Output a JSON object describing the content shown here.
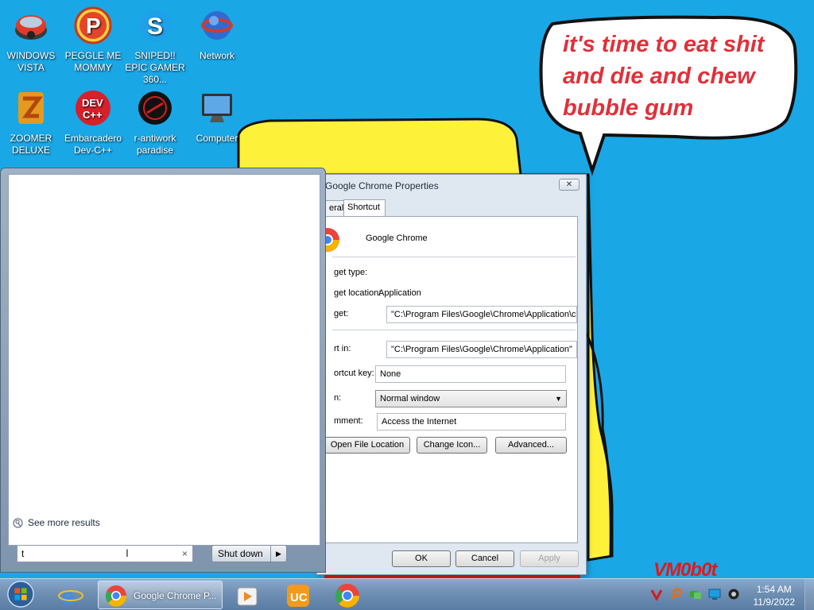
{
  "desktop": {
    "meme_text": "it's time to eat shit and die and chew bubble gum",
    "watermark": "VM0b0t",
    "icons": [
      {
        "label": "WINDOWS VISTA",
        "icon": "windows-vista-icon"
      },
      {
        "label": "PEGGLE ME MOMMY",
        "icon": "peggle-icon"
      },
      {
        "label": "SNIPED!! EPIC GAMER 360...",
        "icon": "skype-icon"
      },
      {
        "label": "Network",
        "icon": "network-icon"
      },
      {
        "label": "ZOOMER DELUXE",
        "icon": "zoomer-icon"
      },
      {
        "label": "Embarcadero Dev-C++",
        "icon": "devcpp-icon"
      },
      {
        "label": "r-antiwork paradise",
        "icon": "antiwork-icon"
      },
      {
        "label": "Computer",
        "icon": "computer-icon"
      }
    ]
  },
  "properties": {
    "title": "Google Chrome Properties",
    "close": "✕",
    "tabs": {
      "general": "eral",
      "shortcut": "Shortcut"
    },
    "app_name": "Google Chrome",
    "target_type_label": "get type:",
    "target_location_label": "get location:",
    "target_location_value": "Application",
    "target_label": "get:",
    "target_value": "\"C:\\Program Files\\Google\\Chrome\\Application\\ch",
    "start_in_label": "rt in:",
    "start_in_value": "\"C:\\Program Files\\Google\\Chrome\\Application\"",
    "shortcut_key_label": "ortcut key:",
    "shortcut_key_value": "None",
    "run_label": "n:",
    "run_value": "Normal window",
    "comment_label": "mment:",
    "comment_value": "Access the Internet",
    "open_file_location": "Open File Location",
    "change_icon": "Change Icon...",
    "advanced": "Advanced...",
    "ok": "OK",
    "cancel": "Cancel",
    "apply": "Apply"
  },
  "start_menu": {
    "see_more": "See more results",
    "search_value": "t",
    "search_clear": "×",
    "shutdown": "Shut down"
  },
  "taskbar": {
    "active_window": "Google Chrome P...",
    "time": "1:54 AM",
    "date": "11/9/2022"
  },
  "colors": {
    "wallpaper": "#1aa7e6",
    "meme_text": "#e0303a",
    "blob": "#fdf13a"
  }
}
